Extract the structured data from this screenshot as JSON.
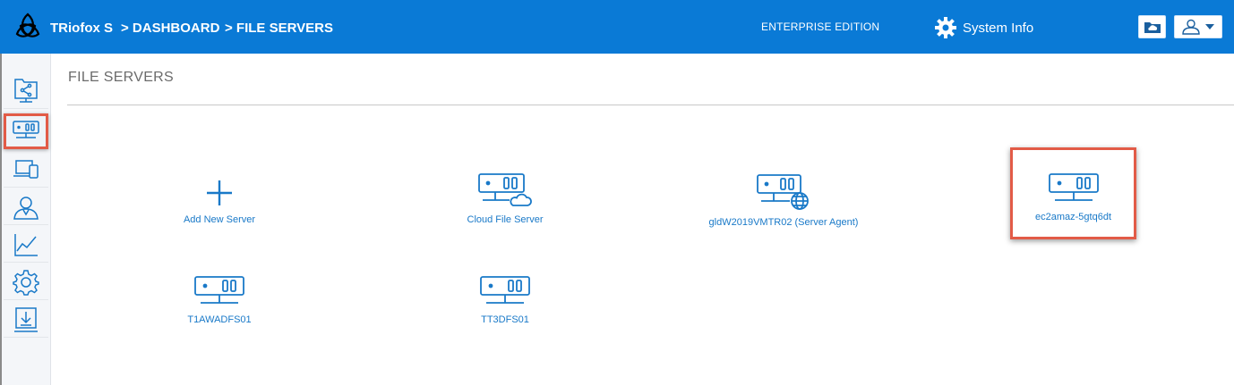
{
  "header": {
    "brand": "TRiofox S",
    "breadcrumb": [
      ">  DASHBOARD",
      ">  FILE SERVERS"
    ],
    "edition": "ENTERPRISE EDITION",
    "system_info": "System Info"
  },
  "sidebar": {
    "items": [
      {
        "name": "shared-folder-icon",
        "active": false
      },
      {
        "name": "file-server-icon",
        "active": true
      },
      {
        "name": "devices-icon",
        "active": false
      },
      {
        "name": "users-icon",
        "active": false
      },
      {
        "name": "reports-chart-icon",
        "active": false
      },
      {
        "name": "settings-gear-icon",
        "active": false
      },
      {
        "name": "download-icon",
        "active": false
      }
    ]
  },
  "main": {
    "title": "FILE SERVERS",
    "tiles": [
      {
        "label": "Add New Server",
        "icon": "plus-icon"
      },
      {
        "label": "Cloud File Server",
        "icon": "server-cloud-icon"
      },
      {
        "label": "gldW2019VMTR02 (Server Agent)",
        "icon": "server-globe-icon"
      },
      {
        "label": "ec2amaz-5gtq6dt",
        "icon": "server-icon",
        "selected": true
      },
      {
        "label": "T1AWADFS01",
        "icon": "server-icon"
      },
      {
        "label": "TT3DFS01",
        "icon": "server-icon"
      }
    ]
  },
  "colors": {
    "brand_blue": "#0a7ad6",
    "link_blue": "#1979c8",
    "highlight": "#e25b47"
  }
}
